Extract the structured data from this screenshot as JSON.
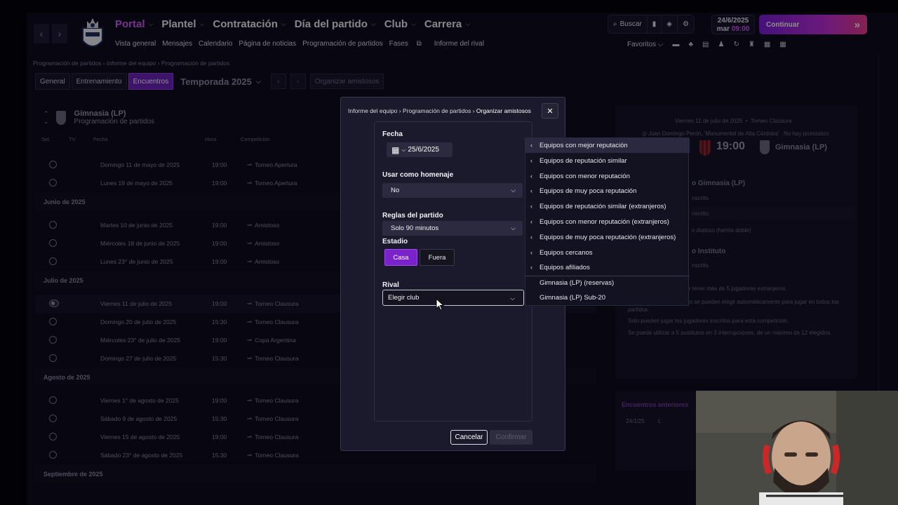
{
  "topbar": {
    "main_nav": [
      {
        "label": "Portal",
        "active": true
      },
      {
        "label": "Plantel",
        "active": false
      },
      {
        "label": "Contratación",
        "active": false
      },
      {
        "label": "Día del partido",
        "active": false
      },
      {
        "label": "Club",
        "active": false
      },
      {
        "label": "Carrera",
        "active": false
      }
    ],
    "sub_nav": [
      "Vista general",
      "Mensajes",
      "Calendario",
      "Página de noticias",
      "Programación de partidos",
      "Fases",
      "Informe del rival"
    ],
    "search_label": "Buscar",
    "date": "24/6/2025",
    "day": "mar",
    "time": "09:00",
    "continue_label": "Continuar",
    "favorites_label": "Favoritos"
  },
  "breadcrumb": [
    "Programación de partidos",
    "Informe del equipo",
    "Programación de partidos"
  ],
  "tabs": [
    {
      "label": "General",
      "active": false
    },
    {
      "label": "Entrenamiento",
      "active": false
    },
    {
      "label": "Encuentros",
      "active": true
    }
  ],
  "season_label": "Temporada 2025",
  "organize_label": "Organizar amistosos",
  "club": {
    "name": "Gimnasia (LP)",
    "subtitle": "Programación de partidos"
  },
  "columns": [
    "Sel.",
    "TV",
    "Fecha",
    "Hora",
    "Competición"
  ],
  "schedule": [
    {
      "type": "row",
      "date": "Domingo 11 de mayo de 2025",
      "time": "19:00",
      "comp": "Torneo Apertura"
    },
    {
      "type": "row",
      "date": "Lunes 19 de mayo de 2025",
      "time": "19:00",
      "comp": "Torneo Apertura"
    },
    {
      "type": "month",
      "label": "Junio de 2025"
    },
    {
      "type": "row",
      "date": "Martes 10 de junio de 2025",
      "time": "19:00",
      "comp": "Amistoso"
    },
    {
      "type": "row",
      "date": "Miércoles 18 de junio de 2025",
      "time": "19:00",
      "comp": "Amistoso"
    },
    {
      "type": "row",
      "date": "Lunes 23° de junio de 2025",
      "time": "19:00",
      "comp": "Amistoso"
    },
    {
      "type": "month",
      "label": "Julio de 2025"
    },
    {
      "type": "row",
      "date": "Viernes 11 de julio de 2025",
      "time": "19:00",
      "comp": "Torneo Clausura",
      "selected": true
    },
    {
      "type": "row",
      "date": "Domingo 20 de julio de 2025",
      "time": "15:30",
      "comp": "Torneo Clausura"
    },
    {
      "type": "row",
      "date": "Miércoles 23° de julio de 2025",
      "time": "19:00",
      "comp": "Copa Argentina"
    },
    {
      "type": "row",
      "date": "Domingo 27 de julio de 2025",
      "time": "15:30",
      "comp": "Torneo Clausura"
    },
    {
      "type": "month",
      "label": "Agosto de 2025"
    },
    {
      "type": "row",
      "date": "Viernes 1° de agosto de 2025",
      "time": "19:00",
      "comp": "Torneo Clausura"
    },
    {
      "type": "row",
      "date": "Sábado 9 de agosto de 2025",
      "time": "15:30",
      "comp": "Torneo Clausura"
    },
    {
      "type": "row",
      "date": "Viernes 15 de agosto de 2025",
      "time": "19:00",
      "comp": "Torneo Clausura"
    },
    {
      "type": "row",
      "date": "Sábado 23° de agosto de 2025",
      "time": "15:30",
      "comp": "Torneo Clausura"
    },
    {
      "type": "month",
      "label": "Septiembre de 2025"
    }
  ],
  "match_panel": {
    "date": "Viernes 11 de julio de 2025",
    "competition": "Torneo Clausura",
    "venue": "Juan Domingo Perón, 'Monumental de Alta Córdoba'",
    "forecast": "No hay pronóstico",
    "home_team_partial": "to",
    "time": "19:00",
    "away_team": "Gimnasia (LP)",
    "team_section": "o Gimnasia (LP)",
    "lines": [
      "nscrito.",
      "nscrito.",
      "o dudoso (hernia doble)"
    ],
    "rival_section": "o Instituto",
    "rival_line": "nscrito.",
    "rules": [
      "e tener más de 5 jugadores extranjeros.",
      "es con contratos juveniles se pueden elegir automáticamente para jugar en todos los partidos.",
      "Solo pueden jugar los jugadores inscritos para esta competición.",
      "Se puede utilizar a 5 sustitutos en 3 interrupciones, de un máximo de 12 elegidos."
    ],
    "previous_title": "Encuentros anteriores",
    "previous_row": {
      "date": "24/1/25",
      "result": "L"
    }
  },
  "modal": {
    "breadcrumb": [
      "Informe del equipo",
      "Programación de partidos",
      "Organizar amistosos"
    ],
    "fecha_label": "Fecha",
    "fecha_value": "25/6/2025",
    "homenaje_label": "Usar como homenaje",
    "homenaje_value": "No",
    "reglas_label": "Reglas del partido",
    "reglas_value": "Solo 90 minutos",
    "estadio_label": "Estadio",
    "casa_label": "Casa",
    "fuera_label": "Fuera",
    "rival_label": "Rival",
    "rival_placeholder": "Elegir club",
    "cancel_label": "Cancelar",
    "confirm_label": "Confirmar"
  },
  "dropdown": {
    "groups": [
      "Equipos con mejor reputación",
      "Equipos de reputación similar",
      "Equipos con menor reputación",
      "Equipos de muy poca reputación",
      "Equipos de reputación similar (extranjeros)",
      "Equipos con menor reputación (extranjeros)",
      "Equipos de muy poca reputación (extranjeros)",
      "Equipos cercanos",
      "Equipos afiliados"
    ],
    "clubs": [
      "Gimnasia (LP) (reservas)",
      "Gimnasia (LP) Sub-20"
    ]
  },
  "colors": {
    "accent": "#d35cf5",
    "tab_active": "#6d23b8",
    "continue_from": "#7a1fd6",
    "continue_to": "#ee3c8b"
  }
}
